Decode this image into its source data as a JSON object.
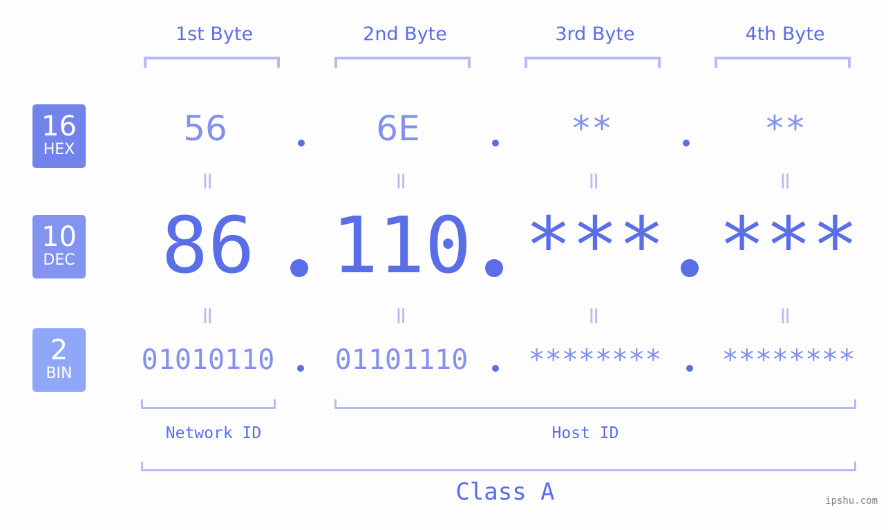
{
  "bytes": [
    {
      "header": "1st Byte",
      "hex": "56",
      "dec": "86",
      "bin": "01010110"
    },
    {
      "header": "2nd Byte",
      "hex": "6E",
      "dec": "110",
      "bin": "01101110"
    },
    {
      "header": "3rd Byte",
      "hex": "**",
      "dec": "***",
      "bin": "********"
    },
    {
      "header": "4th Byte",
      "hex": "**",
      "dec": "***",
      "bin": "********"
    }
  ],
  "badges": {
    "hex": {
      "number": "16",
      "label": "HEX",
      "color": "#7383ec"
    },
    "dec": {
      "number": "10",
      "label": "DEC",
      "color": "#8393f0"
    },
    "bin": {
      "number": "2",
      "label": "BIN",
      "color": "#8fa7f7"
    }
  },
  "equals_symbol": "=",
  "network_id_label": "Network ID",
  "host_id_label": "Host ID",
  "class_label": "Class A",
  "watermark": "ipshu.com",
  "colors": {
    "accent": "#5a6ee8",
    "light_accent": "#8291ee",
    "bracket": "#b3bcf5",
    "background": "#fcfdfc"
  }
}
